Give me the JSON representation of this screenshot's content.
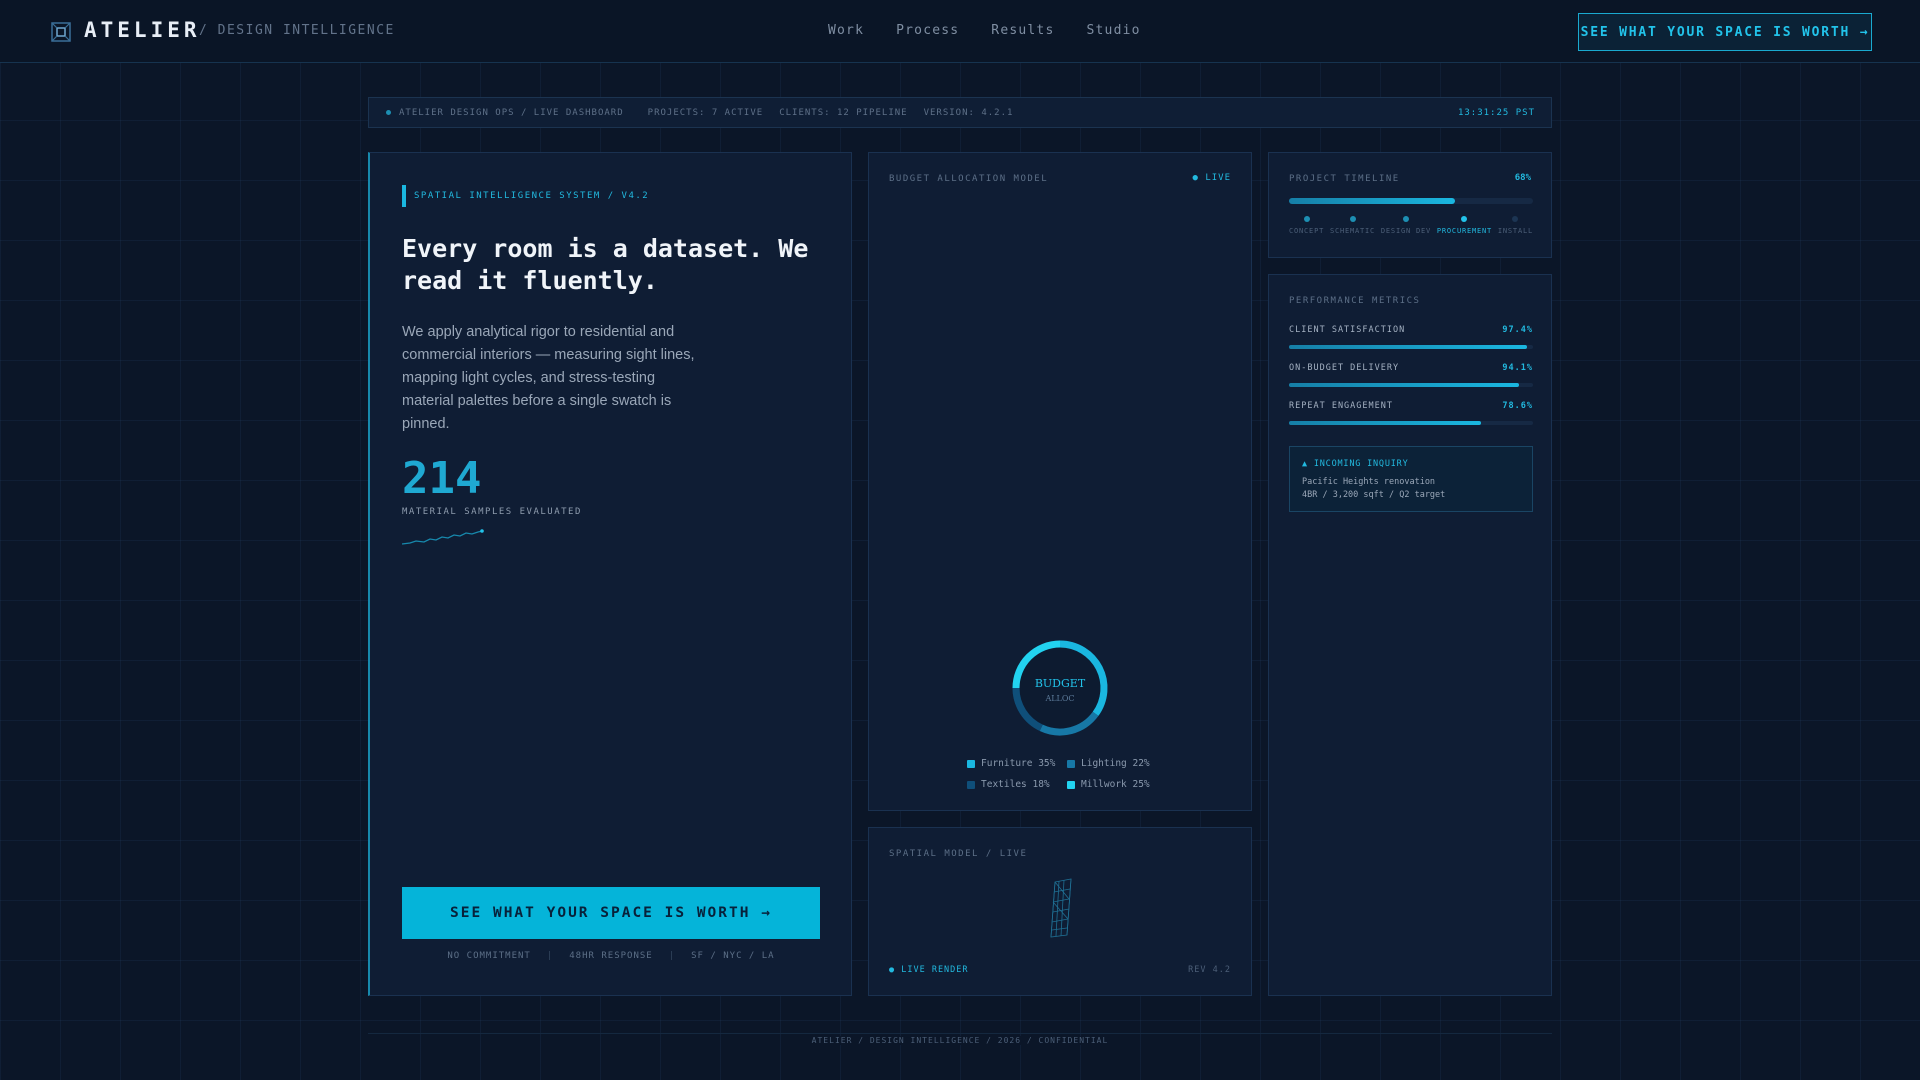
{
  "nav": {
    "brand": "ATELIER",
    "brand_sub": "/ DESIGN INTELLIGENCE",
    "brand_icon": "grid-cube-icon",
    "links": [
      "Work",
      "Process",
      "Results",
      "Studio"
    ],
    "cta": "SEE WHAT YOUR SPACE IS WORTH →"
  },
  "status_bar": {
    "title": "ATELIER DESIGN OPS / LIVE DASHBOARD",
    "projects": "PROJECTS: 7 ACTIVE",
    "clients": "CLIENTS: 12 PIPELINE",
    "version": "VERSION: 4.2.1",
    "time": "13:31:25 PST"
  },
  "hero": {
    "tag": "SPATIAL INTELLIGENCE SYSTEM / V4.2",
    "headline": "Every room is a dataset. We read it fluently.",
    "body": "We apply analytical rigor to residential and commercial interiors — measuring sight lines, mapping light cycles, and stress-testing material palettes before a single swatch is pinned.",
    "stat_value": "214",
    "stat_label": "MATERIAL SAMPLES EVALUATED",
    "cta": "SEE WHAT YOUR SPACE IS WORTH →",
    "footnotes": [
      "NO COMMITMENT",
      "48HR RESPONSE",
      "SF / NYC / LA"
    ]
  },
  "budget": {
    "title": "BUDGET ALLOCATION MODEL",
    "live": "● LIVE",
    "donut_line1": "BUDGET",
    "donut_line2": "ALLOC",
    "legend": [
      {
        "label": "Furniture 35%",
        "color": "#1ab7e0"
      },
      {
        "label": "Lighting 22%",
        "color": "#1778a6"
      },
      {
        "label": "Textiles 18%",
        "color": "#0f4f7a"
      },
      {
        "label": "Millwork 25%",
        "color": "#22d3f0"
      }
    ]
  },
  "chart_data": {
    "type": "pie",
    "categories": [
      "Furniture",
      "Lighting",
      "Textiles",
      "Millwork"
    ],
    "values": [
      35,
      22,
      18,
      25
    ],
    "title": "BUDGET ALLOCATION MODEL"
  },
  "spatial": {
    "title": "SPATIAL MODEL / LIVE",
    "live": "● LIVE RENDER",
    "rev": "REV 4.2"
  },
  "timeline": {
    "title": "PROJECT TIMELINE",
    "percent": "68%",
    "progress": 0.68,
    "steps": [
      {
        "label": "CONCEPT",
        "state": "done"
      },
      {
        "label": "SCHEMATIC",
        "state": "done"
      },
      {
        "label": "DESIGN DEV",
        "state": "done"
      },
      {
        "label": "PROCUREMENT",
        "state": "current"
      },
      {
        "label": "INSTALL",
        "state": "future"
      }
    ]
  },
  "metrics": {
    "title": "PERFORMANCE METRICS",
    "items": [
      {
        "label": "CLIENT SATISFACTION",
        "value": "97.4%",
        "fraction": 0.974
      },
      {
        "label": "ON-BUDGET DELIVERY",
        "value": "94.1%",
        "fraction": 0.941
      },
      {
        "label": "REPEAT ENGAGEMENT",
        "value": "78.6%",
        "fraction": 0.786
      }
    ],
    "inquiry": {
      "title": "▲ INCOMING INQUIRY",
      "line1": "Pacific Heights renovation",
      "line2": "4BR / 3,200 sqft / Q2 target"
    }
  },
  "footer": "ATELIER / DESIGN INTELLIGENCE / 2026 / CONFIDENTIAL"
}
